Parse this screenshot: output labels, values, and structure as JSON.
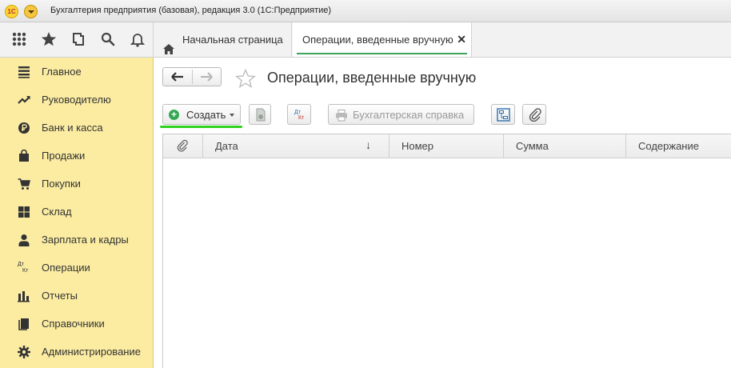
{
  "window": {
    "title": "Бухгалтерия предприятия (базовая), редакция 3.0  (1С:Предприятие)",
    "logo_text": "1С"
  },
  "tabs": [
    {
      "label": "Начальная страница",
      "active": false
    },
    {
      "label": "Операции, введенные вручную",
      "active": true,
      "close": "✕"
    }
  ],
  "toolbar_icons": [
    "apps-grid-icon",
    "star-icon",
    "history-icon",
    "search-icon",
    "bell-icon"
  ],
  "sidebar": {
    "items": [
      {
        "label": "Главное",
        "icon": "menu-lines-icon"
      },
      {
        "label": "Руководителю",
        "icon": "trend-icon"
      },
      {
        "label": "Банк и касса",
        "icon": "ruble-icon"
      },
      {
        "label": "Продажи",
        "icon": "shopping-bag-icon"
      },
      {
        "label": "Покупки",
        "icon": "cart-icon"
      },
      {
        "label": "Склад",
        "icon": "warehouse-icon"
      },
      {
        "label": "Зарплата и кадры",
        "icon": "person-icon"
      },
      {
        "label": "Операции",
        "icon": "dt-kt-icon",
        "icon_text_top": "Дт",
        "icon_text_bottom": "Кт"
      },
      {
        "label": "Отчеты",
        "icon": "bar-chart-icon"
      },
      {
        "label": "Справочники",
        "icon": "books-icon"
      },
      {
        "label": "Администрирование",
        "icon": "gear-icon"
      }
    ]
  },
  "page": {
    "title": "Операции, введенные вручную"
  },
  "commands": {
    "create_label": "Создать",
    "dtkt_top": "Дт",
    "dtkt_bottom": "Кт",
    "report_label": "Бухгалтерская справка"
  },
  "table": {
    "columns": [
      "Дата",
      "Номер",
      "Сумма",
      "Содержание"
    ],
    "sort_indicator": "↓",
    "rows": []
  },
  "colors": {
    "sidebar_bg": "#fbeca2",
    "accent_green": "#2ed11d",
    "tab_underline": "#3aa35c"
  }
}
